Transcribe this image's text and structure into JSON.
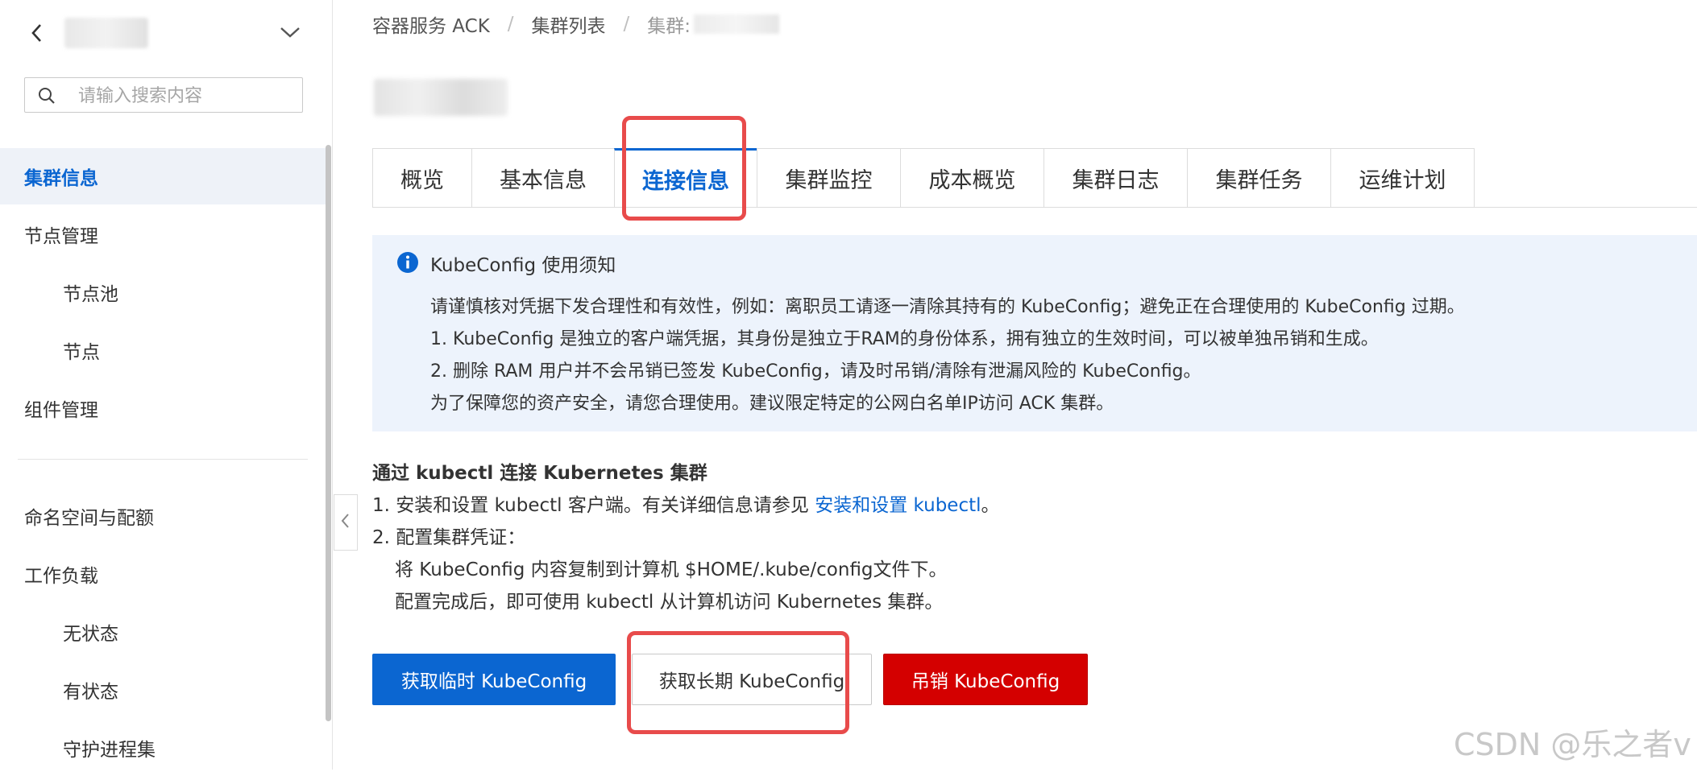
{
  "sidebar": {
    "search_placeholder": "请输入搜索内容",
    "items": [
      {
        "label": "集群信息",
        "active": true,
        "level": 1
      },
      {
        "label": "节点管理",
        "active": false,
        "level": 1
      },
      {
        "label": "节点池",
        "active": false,
        "level": 2
      },
      {
        "label": "节点",
        "active": false,
        "level": 2
      },
      {
        "label": "组件管理",
        "active": false,
        "level": 1
      },
      {
        "label": "命名空间与配额",
        "active": false,
        "level": 1
      },
      {
        "label": "工作负载",
        "active": false,
        "level": 1
      },
      {
        "label": "无状态",
        "active": false,
        "level": 2
      },
      {
        "label": "有状态",
        "active": false,
        "level": 2
      },
      {
        "label": "守护进程集",
        "active": false,
        "level": 2
      }
    ]
  },
  "breadcrumb": {
    "items": [
      "容器服务 ACK",
      "集群列表"
    ],
    "current_prefix": "集群:"
  },
  "tabs": [
    {
      "label": "概览",
      "active": false
    },
    {
      "label": "基本信息",
      "active": false
    },
    {
      "label": "连接信息",
      "active": true
    },
    {
      "label": "集群监控",
      "active": false
    },
    {
      "label": "成本概览",
      "active": false
    },
    {
      "label": "集群日志",
      "active": false
    },
    {
      "label": "集群任务",
      "active": false
    },
    {
      "label": "运维计划",
      "active": false
    }
  ],
  "notice": {
    "title": "KubeConfig 使用须知",
    "lines": [
      "请谨慎核对凭据下发合理性和有效性，例如：离职员工请逐一清除其持有的 KubeConfig；避免正在合理使用的 KubeConfig 过期。",
      "1. KubeConfig 是独立的客户端凭据，其身份是独立于RAM的身份体系，拥有独立的生效时间，可以被单独吊销和生成。",
      "2. 删除 RAM 用户并不会吊销已签发 KubeConfig，请及时吊销/清除有泄漏风险的 KubeConfig。",
      "为了保障您的资产安全，请您合理使用。建议限定特定的公网白名单IP访问 ACK 集群。"
    ]
  },
  "kubectl": {
    "title": "通过 kubectl 连接 Kubernetes 集群",
    "step1_prefix": "1. 安装和设置 kubectl 客户端。有关详细信息请参见 ",
    "step1_link": "安装和设置 kubectl",
    "step1_suffix": "。",
    "step2": "2. 配置集群凭证：",
    "step2_line1": "将 KubeConfig 内容复制到计算机 $HOME/.kube/config文件下。",
    "step2_line2": "配置完成后，即可使用 kubectl 从计算机访问 Kubernetes 集群。"
  },
  "buttons": {
    "temp": "获取临时 KubeConfig",
    "long_term": "获取长期 KubeConfig",
    "revoke": "吊销 KubeConfig"
  },
  "watermark": "CSDN @乐之者v",
  "colors": {
    "accent": "#0b66d1",
    "danger": "#d40000",
    "highlight": "#e84b4b",
    "notice_bg": "#edf3fc"
  }
}
